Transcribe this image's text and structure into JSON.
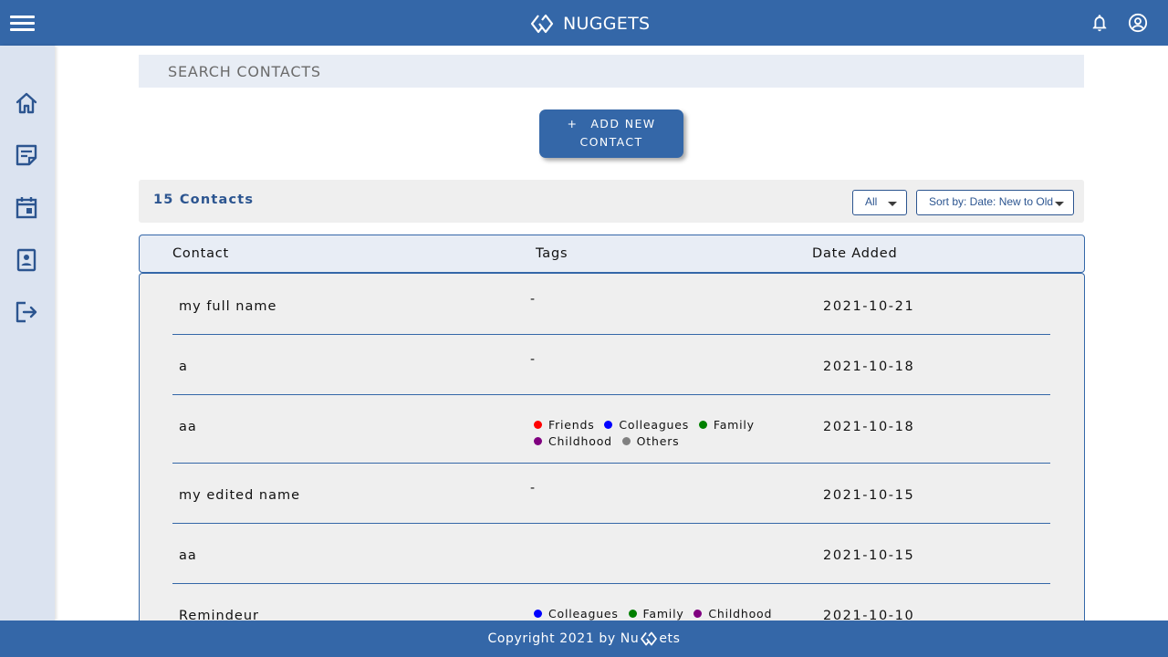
{
  "header": {
    "title": "NUGGETS",
    "menu_icon": "hamburger-menu-icon",
    "logo_icon": "diamond-logo-icon",
    "notifications_icon": "bell-icon",
    "account_icon": "user-circle-icon"
  },
  "sidebar": {
    "items": [
      {
        "name": "home",
        "icon": "home-icon"
      },
      {
        "name": "notes",
        "icon": "note-icon"
      },
      {
        "name": "calendar",
        "icon": "calendar-icon"
      },
      {
        "name": "contacts",
        "icon": "contact-book-icon"
      },
      {
        "name": "logout",
        "icon": "logout-icon"
      }
    ]
  },
  "search": {
    "placeholder": "SEARCH CONTACTS",
    "value": ""
  },
  "add_button": {
    "plus": "+",
    "line1": "ADD NEW",
    "line2": "CONTACT"
  },
  "contacts_bar": {
    "count_label": "15 Contacts",
    "filter": {
      "selected": "All"
    },
    "sort": {
      "selected": "Sort by: Date: New to Old"
    }
  },
  "table": {
    "columns": [
      "Contact",
      "Tags",
      "Date Added"
    ],
    "rows": [
      {
        "name": "my full name",
        "tags_text": "-",
        "date": "2021-10-21"
      },
      {
        "name": "a",
        "tags_text": "-",
        "date": "2021-10-18"
      },
      {
        "name": "aa",
        "tags": [
          "Friends",
          "Colleagues",
          "Family",
          "Childhood",
          "Others"
        ],
        "date": "2021-10-18"
      },
      {
        "name": "my edited name",
        "tags_text": "-",
        "date": "2021-10-15"
      },
      {
        "name": "aa",
        "tags_text": "",
        "date": "2021-10-15"
      },
      {
        "name": "Remindeur",
        "tags": [
          "Colleagues",
          "Family",
          "Childhood"
        ],
        "date": "2021-10-10"
      }
    ]
  },
  "tag_colors": {
    "Friends": "#ff0000",
    "Colleagues": "#0000ff",
    "Family": "#008000",
    "Childhood": "#800080",
    "Others": "#808080"
  },
  "footer": {
    "prefix": "Copyright 2021 by Nu",
    "suffix": "ets"
  },
  "colors": {
    "primary": "#3467a8",
    "sidebar": "#dbe3f0",
    "panel": "#efefef",
    "accent_text": "#2c5590"
  }
}
